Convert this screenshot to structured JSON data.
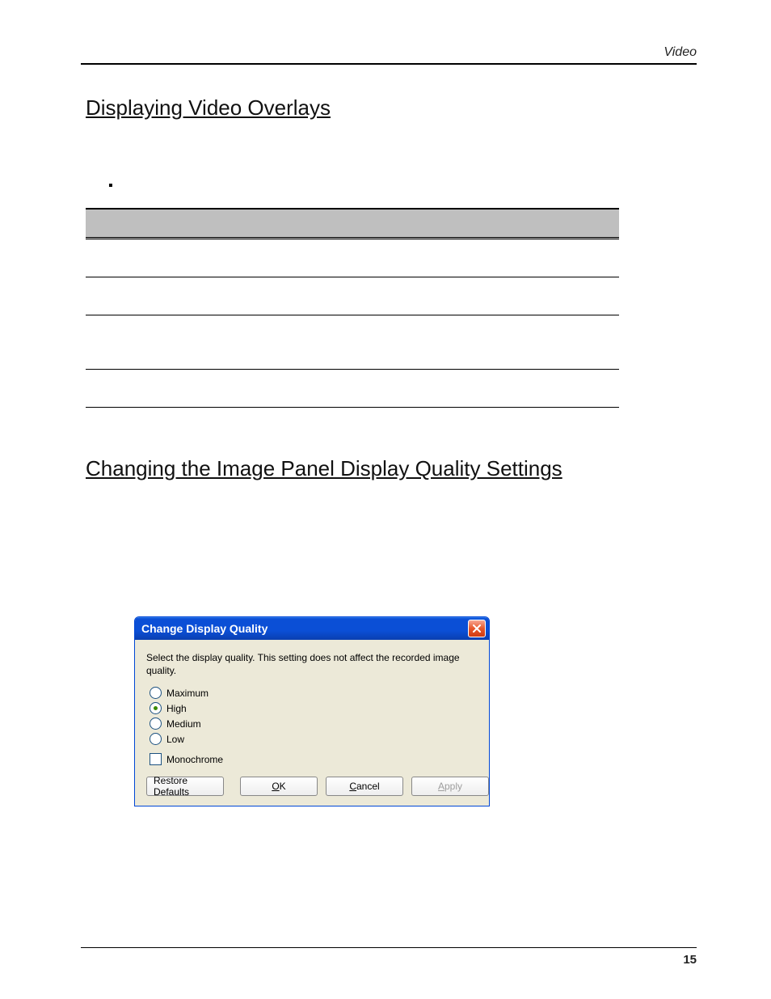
{
  "header": {
    "section": "Video"
  },
  "section1": {
    "title": "Displaying Video Overlays"
  },
  "section2": {
    "title": "Changing the Image Panel Display Quality Settings"
  },
  "dialog": {
    "title": "Change Display Quality",
    "description": "Select the display quality.  This setting does not affect the recorded image quality.",
    "options": [
      "Maximum",
      "High",
      "Medium",
      "Low"
    ],
    "selected": "High",
    "monochrome": "Monochrome",
    "monochrome_checked": false,
    "buttons": {
      "restore": "Restore Defaults",
      "ok_u": "O",
      "ok_rest": "K",
      "cancel_u": "C",
      "cancel_rest": "ancel",
      "apply_u": "A",
      "apply_rest": "pply",
      "apply_enabled": false
    }
  },
  "footer": {
    "page": "15"
  }
}
